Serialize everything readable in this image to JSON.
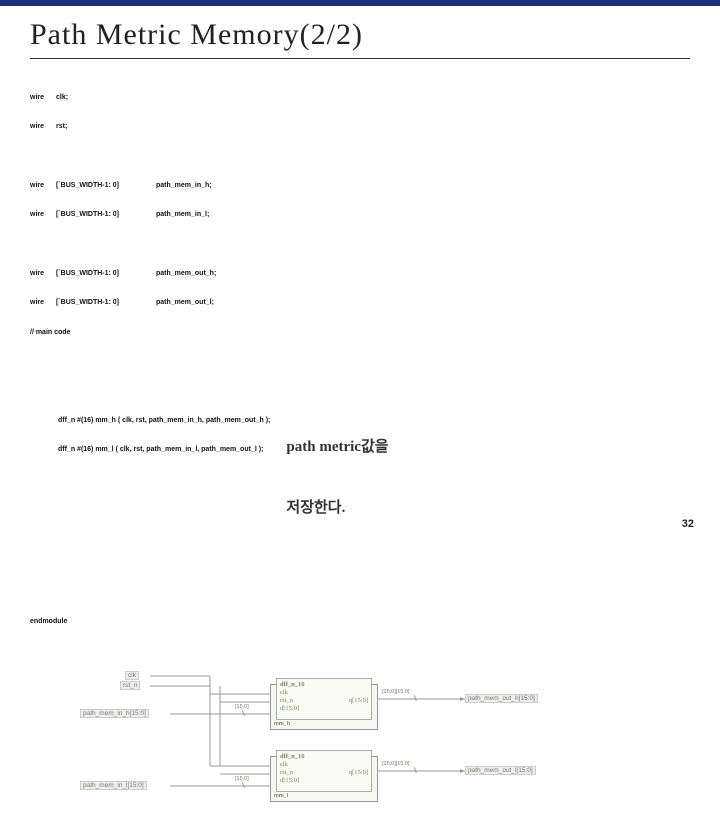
{
  "title": "Path Metric Memory(2/2)",
  "pagenum": "32",
  "code": {
    "wire": "wire",
    "clk": "clk;",
    "rst": "rst;",
    "bus": "[`BUS_WIDTH-1: 0]",
    "pmi_h": "path_mem_in_h;",
    "pmi_l": "path_mem_in_l;",
    "pmo_h": "path_mem_out_h;",
    "pmo_l": "path_mem_out_l;",
    "maincode": "// main code",
    "dff_h": "dff_n #(16) mm_h ( clk, rst, path_mem_in_h, path_mem_out_h );",
    "dff_l": "dff_n #(16) mm_l ( clk, rst, path_mem_in_l, path_mem_out_l );",
    "endmodule": "endmodule"
  },
  "annotation": {
    "line1": "path metric값을",
    "line2": "저장한다."
  },
  "diagram": {
    "top_port": "clk",
    "rst_port": "rst_n",
    "block_title_h": "dff_n_16",
    "block_name_h": "mm_h",
    "block_title_l": "dff_n_16",
    "block_name_l": "mm_l",
    "inner_clk": "clk",
    "inner_rst": "rst_n",
    "inner_d": "d[15:0]",
    "inner_q": "q[15:0]",
    "port_in_h": "path_mem_in_h[15:0]",
    "port_in_l": "path_mem_in_l[15:0]",
    "port_out_h": "path_mem_out_h[15:0]",
    "port_out_l": "path_mem_out_l[15:0]",
    "bus15": "[15:0]",
    "busbits": "[15:0][15:0]"
  }
}
